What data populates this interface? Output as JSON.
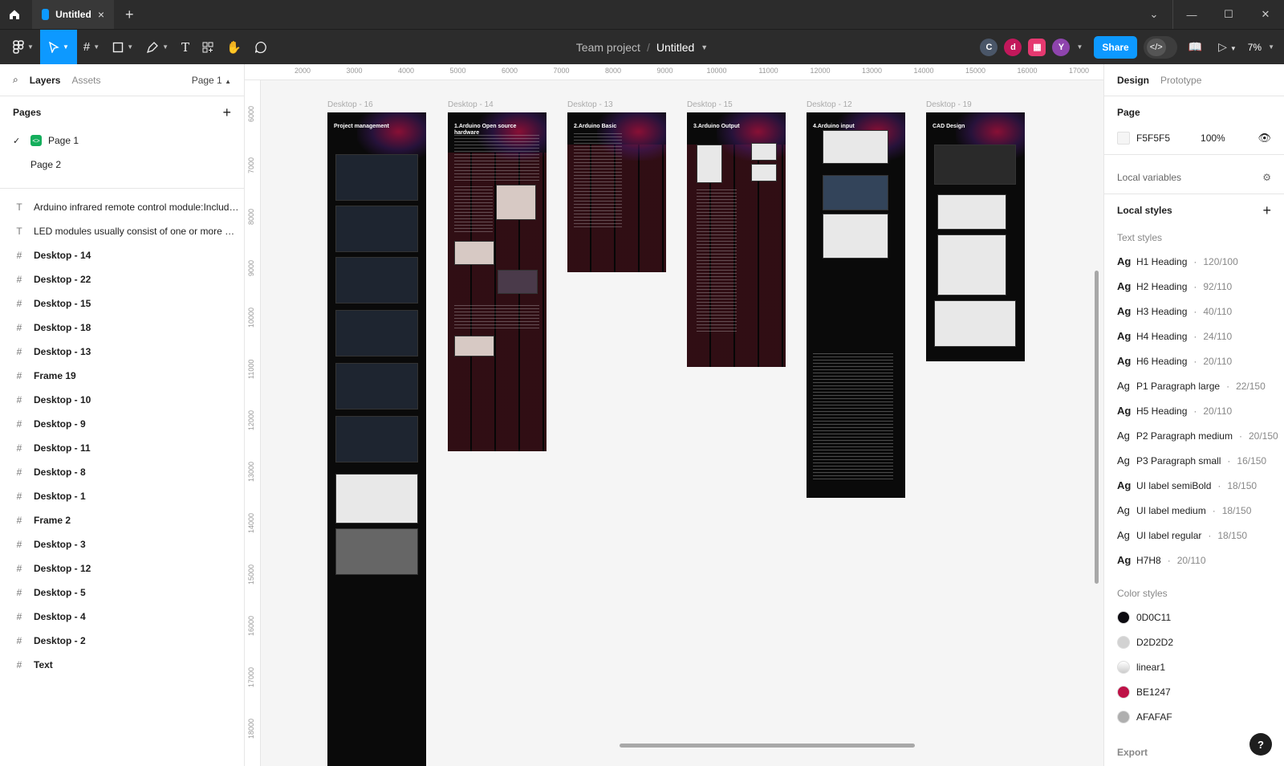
{
  "titlebar": {
    "tab_title": "Untitled",
    "close_glyph": "×",
    "plus_glyph": "+",
    "window_controls": [
      "⌄",
      "—",
      "☐",
      "✕"
    ]
  },
  "toolbar": {
    "team": "Team project",
    "separator": "/",
    "file_name": "Untitled",
    "avatars": [
      {
        "letter": "C",
        "color": "#4a5668"
      },
      {
        "letter": "d",
        "color": "#c2185b"
      },
      {
        "letter": "▦",
        "color": "#e53970"
      },
      {
        "letter": "Y",
        "color": "#8e44ad"
      }
    ],
    "share_label": "Share",
    "zoom_label": "7%"
  },
  "left_panel": {
    "tab_layers": "Layers",
    "tab_assets": "Assets",
    "page_selector": "Page 1",
    "pages_heading": "Pages",
    "pages": [
      {
        "label": "Page 1",
        "current": true
      },
      {
        "label": "Page 2",
        "current": false
      }
    ],
    "layers": [
      {
        "label": "Arduino infrared remote control module:Includes I...",
        "type": "text"
      },
      {
        "label": "LED modules usually consist of one or more LED li...",
        "type": "text"
      },
      {
        "label": "Desktop - 14",
        "type": "frame"
      },
      {
        "label": "Desktop - 22",
        "type": "frame"
      },
      {
        "label": "Desktop - 15",
        "type": "frame"
      },
      {
        "label": "Desktop - 18",
        "type": "frame"
      },
      {
        "label": "Desktop - 13",
        "type": "frame"
      },
      {
        "label": "Frame 19",
        "type": "frame"
      },
      {
        "label": "Desktop - 10",
        "type": "frame"
      },
      {
        "label": "Desktop - 9",
        "type": "frame"
      },
      {
        "label": "Desktop - 11",
        "type": "frame"
      },
      {
        "label": "Desktop - 8",
        "type": "frame"
      },
      {
        "label": "Desktop - 1",
        "type": "frame"
      },
      {
        "label": "Frame 2",
        "type": "frame"
      },
      {
        "label": "Desktop - 3",
        "type": "frame"
      },
      {
        "label": "Desktop - 12",
        "type": "frame"
      },
      {
        "label": "Desktop - 5",
        "type": "frame"
      },
      {
        "label": "Desktop - 4",
        "type": "frame"
      },
      {
        "label": "Desktop - 2",
        "type": "frame"
      },
      {
        "label": "Text",
        "type": "frame"
      }
    ]
  },
  "canvas": {
    "ruler_x": [
      "2000",
      "3000",
      "4000",
      "5000",
      "6000",
      "7000",
      "8000",
      "9000",
      "10000",
      "11000",
      "12000",
      "13000",
      "14000",
      "15000",
      "16000",
      "17000"
    ],
    "ruler_y": [
      "6000",
      "7000",
      "8000",
      "9000",
      "10000",
      "11000",
      "12000",
      "13000",
      "14000",
      "15000",
      "16000",
      "17000",
      "18000"
    ],
    "artboards": [
      {
        "label": "Desktop - 16",
        "title": "Project management"
      },
      {
        "label": "Desktop - 14",
        "title": "1.Arduino Open source hardware"
      },
      {
        "label": "Desktop - 13",
        "title": "2.Arduino Basic"
      },
      {
        "label": "Desktop - 15",
        "title": "3.Arduino Output"
      },
      {
        "label": "Desktop - 12",
        "title": "4.Arduino input"
      },
      {
        "label": "Desktop - 19",
        "title": "CAD Design"
      }
    ]
  },
  "right_panel": {
    "tab_design": "Design",
    "tab_prototype": "Prototype",
    "page_heading": "Page",
    "page_color": "F5F5F5",
    "page_opacity": "100%",
    "local_variables": "Local variables",
    "local_styles": "Local styles",
    "text_styles_heading": "Text styles",
    "text_styles": [
      {
        "name": "H1 Heading",
        "meta": "120/100",
        "bold": true
      },
      {
        "name": "H2 Heading",
        "meta": "92/110",
        "bold": true
      },
      {
        "name": "H3 Heading",
        "meta": "40/110",
        "bold": true
      },
      {
        "name": "H4 Heading",
        "meta": "24/110",
        "bold": true
      },
      {
        "name": "H6 Heading",
        "meta": "20/110",
        "bold": true
      },
      {
        "name": "P1 Paragraph large",
        "meta": "22/150",
        "bold": false
      },
      {
        "name": "H5 Heading",
        "meta": "20/110",
        "bold": true
      },
      {
        "name": "P2 Paragraph medium",
        "meta": "20/150",
        "bold": false
      },
      {
        "name": "P3 Paragraph small",
        "meta": "16/150",
        "bold": false
      },
      {
        "name": "UI label semiBold",
        "meta": "18/150",
        "bold": true
      },
      {
        "name": "UI label medium",
        "meta": "18/150",
        "bold": false
      },
      {
        "name": "UI label regular",
        "meta": "18/150",
        "bold": false
      },
      {
        "name": "H7H8",
        "meta": "20/110",
        "bold": true
      }
    ],
    "color_styles_heading": "Color styles",
    "color_styles": [
      {
        "name": "0D0C11",
        "color": "#0d0c11"
      },
      {
        "name": "D2D2D2",
        "color": "#d2d2d2"
      },
      {
        "name": "linear1",
        "color": "#e8e8e8"
      },
      {
        "name": "BE1247",
        "color": "#be1247"
      },
      {
        "name": "AFAFAF",
        "color": "#afafaf"
      }
    ],
    "export_label": "Export",
    "help_label": "?"
  }
}
